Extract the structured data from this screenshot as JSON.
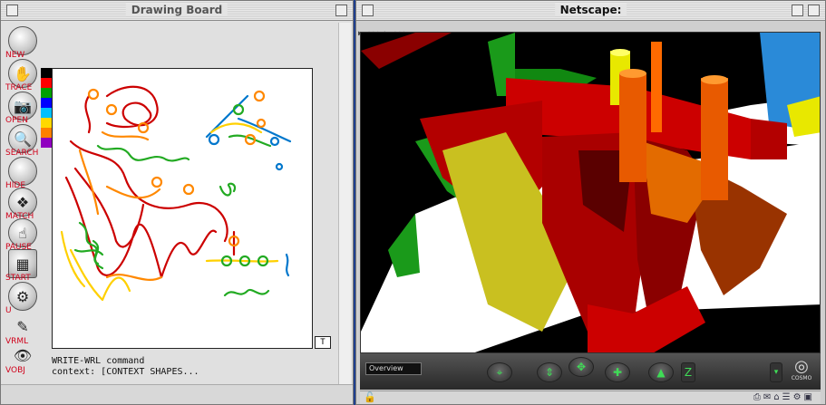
{
  "left_window": {
    "title": "Drawing Board",
    "tools": [
      {
        "label": "NEW",
        "icon": "new-icon",
        "glyph": ""
      },
      {
        "label": "TRACE",
        "icon": "trace-icon",
        "glyph": "✋"
      },
      {
        "label": "OPEN",
        "icon": "camera-icon",
        "glyph": "📷"
      },
      {
        "label": "SEARCH",
        "icon": "magnifier-icon",
        "glyph": "🔍"
      },
      {
        "label": "HIDE",
        "icon": "hide-icon",
        "glyph": ""
      },
      {
        "label": "MATCH",
        "icon": "match-icon",
        "glyph": "❖"
      },
      {
        "label": "PAUSE",
        "icon": "hand-icon",
        "glyph": "☝"
      },
      {
        "label": "START",
        "icon": "start-icon",
        "glyph": "▦"
      },
      {
        "label": "U",
        "icon": "gear-icon",
        "glyph": "⚙"
      },
      {
        "label": "VRML",
        "icon": "vrml-icon",
        "glyph": "✎"
      },
      {
        "label": "VOBJ",
        "icon": "eye-icon",
        "glyph": "👁"
      }
    ],
    "swatch_colors": [
      "#000000",
      "#ff0000",
      "#00a000",
      "#0000ff",
      "#00c0ff",
      "#ffd800",
      "#ff8000",
      "#9000c0"
    ],
    "corner_button": "T",
    "console_lines": [
      "WRITE-WRL command",
      "context: [CONTEXT SHAPES..."
    ]
  },
  "right_window": {
    "title": "Netscape:",
    "nav_text": "▶ ::: ▶ :::",
    "cosmo": {
      "viewpoint": "Overview",
      "logo_text": "COSMO"
    }
  },
  "colors": {
    "stroke_red": "#cc0000",
    "stroke_green": "#22aa22",
    "stroke_orange": "#ff8800",
    "stroke_yellow": "#ffd000",
    "stroke_blue": "#0077cc"
  }
}
